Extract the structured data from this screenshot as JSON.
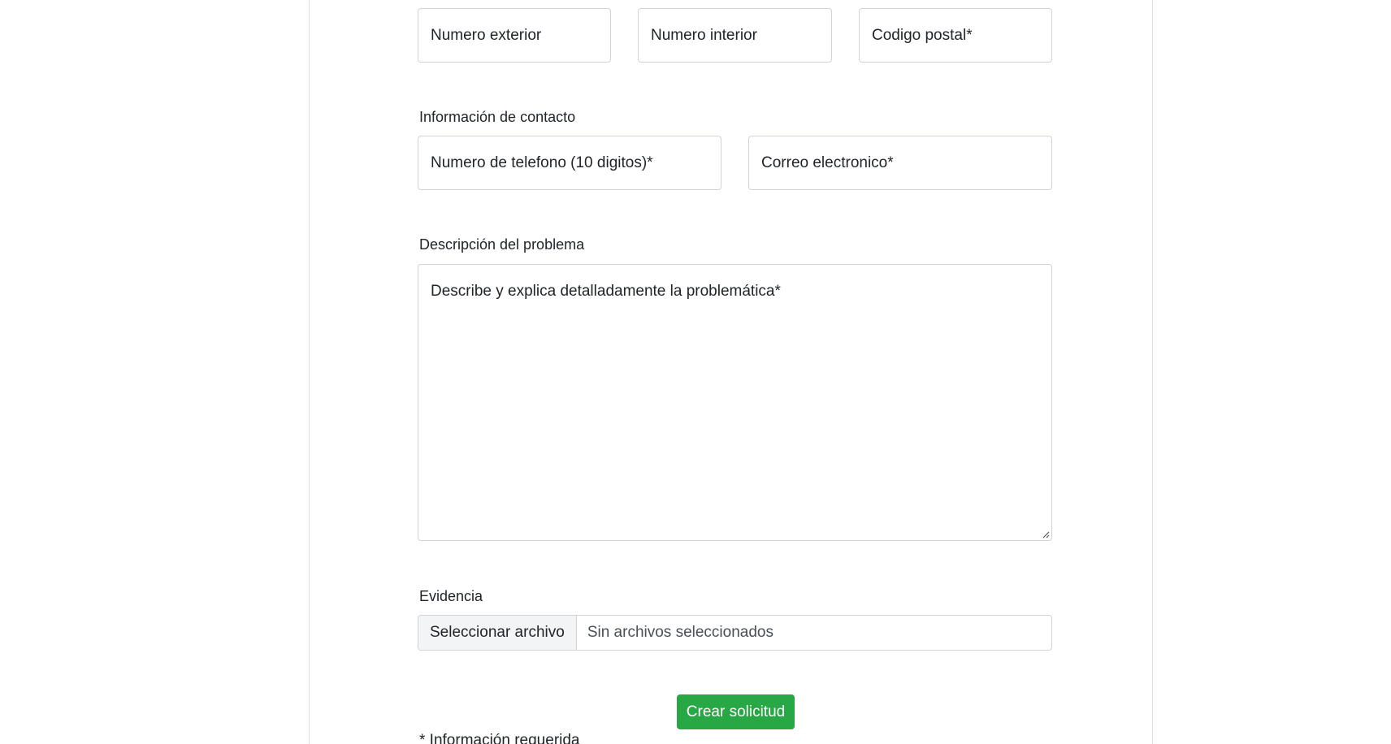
{
  "address": {
    "exterior_number_placeholder": "Numero exterior",
    "interior_number_placeholder": "Numero interior",
    "postal_code_placeholder": "Codigo postal*"
  },
  "contact": {
    "section_label": "Información de contacto",
    "phone_placeholder": "Numero de telefono (10 digitos)*",
    "email_placeholder": "Correo electronico*"
  },
  "description": {
    "section_label": "Descripción del problema",
    "placeholder": "Describe y explica detalladamente la problemática*"
  },
  "evidence": {
    "section_label": "Evidencia",
    "select_button_label": "Seleccionar archivo",
    "status_text": "Sin archivos seleccionados"
  },
  "form": {
    "submit_label": "Crear solicitud",
    "required_note": "* Información requerida",
    "submit_color": "#28a745"
  }
}
